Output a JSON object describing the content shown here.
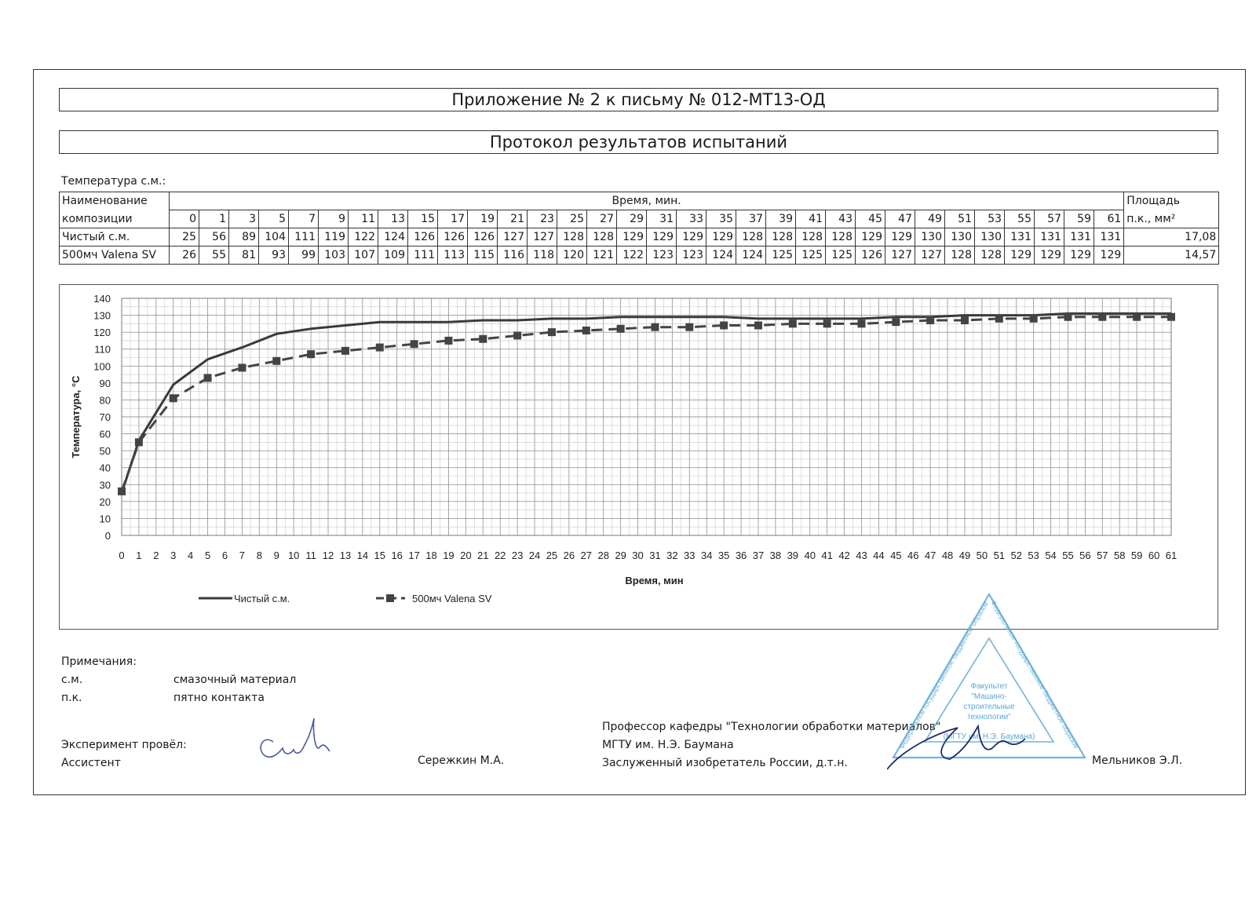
{
  "header": {
    "title": "Приложение № 2 к письму № 012-МТ13-ОД",
    "subtitle": "Протокол результатов испытаний"
  },
  "table": {
    "caption": "Температура с.м.:",
    "name_header": [
      "Наименование",
      "композиции"
    ],
    "time_header": "Время, мин.",
    "area_header": [
      "Площадь",
      "п.к., мм²"
    ],
    "times": [
      "0",
      "1",
      "3",
      "5",
      "7",
      "9",
      "11",
      "13",
      "15",
      "17",
      "19",
      "21",
      "23",
      "25",
      "27",
      "29",
      "31",
      "33",
      "35",
      "37",
      "39",
      "41",
      "43",
      "45",
      "47",
      "49",
      "51",
      "53",
      "55",
      "57",
      "59",
      "61"
    ],
    "rows": [
      {
        "name": "Чистый с.м.",
        "values": [
          "25",
          "56",
          "89",
          "104",
          "111",
          "119",
          "122",
          "124",
          "126",
          "126",
          "126",
          "127",
          "127",
          "128",
          "128",
          "129",
          "129",
          "129",
          "129",
          "128",
          "128",
          "128",
          "128",
          "129",
          "129",
          "130",
          "130",
          "130",
          "131",
          "131",
          "131",
          "131"
        ],
        "area": "17,08"
      },
      {
        "name": "500мч Valena SV",
        "values": [
          "26",
          "55",
          "81",
          "93",
          "99",
          "103",
          "107",
          "109",
          "111",
          "113",
          "115",
          "116",
          "118",
          "120",
          "121",
          "122",
          "123",
          "123",
          "124",
          "124",
          "125",
          "125",
          "125",
          "126",
          "127",
          "127",
          "128",
          "128",
          "129",
          "129",
          "129",
          "129"
        ],
        "area": "14,57"
      }
    ]
  },
  "chart_data": {
    "type": "line",
    "xlabel": "Время, мин",
    "ylabel": "Температура, °С",
    "xlim": [
      0,
      61
    ],
    "ylim": [
      0,
      140
    ],
    "yticks": [
      0,
      10,
      20,
      30,
      40,
      50,
      60,
      70,
      80,
      90,
      100,
      110,
      120,
      130,
      140
    ],
    "grid": true,
    "legend": "bottom-left",
    "series": [
      {
        "name": "Чистый с.м.",
        "style": "solid",
        "color": "#3a3a3a",
        "x": [
          0,
          1,
          3,
          5,
          7,
          9,
          11,
          13,
          15,
          17,
          19,
          21,
          23,
          25,
          27,
          29,
          31,
          33,
          35,
          37,
          39,
          41,
          43,
          45,
          47,
          49,
          51,
          53,
          55,
          57,
          59,
          61
        ],
        "y": [
          25,
          56,
          89,
          104,
          111,
          119,
          122,
          124,
          126,
          126,
          126,
          127,
          127,
          128,
          128,
          129,
          129,
          129,
          129,
          128,
          128,
          128,
          128,
          129,
          129,
          130,
          130,
          130,
          131,
          131,
          131,
          131
        ]
      },
      {
        "name": "500мч Valena SV",
        "style": "dashed-square",
        "color": "#444444",
        "x": [
          0,
          1,
          3,
          5,
          7,
          9,
          11,
          13,
          15,
          17,
          19,
          21,
          23,
          25,
          27,
          29,
          31,
          33,
          35,
          37,
          39,
          41,
          43,
          45,
          47,
          49,
          51,
          53,
          55,
          57,
          59,
          61
        ],
        "y": [
          26,
          55,
          81,
          93,
          99,
          103,
          107,
          109,
          111,
          113,
          115,
          116,
          118,
          120,
          121,
          122,
          123,
          123,
          124,
          124,
          125,
          125,
          125,
          126,
          127,
          127,
          128,
          128,
          129,
          129,
          129,
          129
        ]
      }
    ]
  },
  "notes": {
    "title": "Примечания:",
    "items": [
      {
        "abbr": "с.м.",
        "meaning": "смазочный материал"
      },
      {
        "abbr": "п.к.",
        "meaning": "пятно контакта"
      }
    ]
  },
  "signatures": {
    "left_line1": "Эксперимент провёл:",
    "left_line2": "Ассистент",
    "left_name": "Сережкин М.А.",
    "right_line1": "Профессор кафедры \"Технологии обработки материалов\"",
    "right_line2": "МГТУ им. Н.Э. Баумана",
    "right_line3": "Заслуженный изобретатель России, д.т.н.",
    "right_name": "Мельников Э.Л."
  },
  "stamp": {
    "outer_text": "Федеральное государственное бюджетное образовательное учреждение высшего профессионального образования Московский государственный технический университет имени Н.Э. Баумана",
    "center_text": [
      "Факультет",
      "\"Машино-",
      "строительные",
      "технологии\""
    ],
    "bottom_text": "(МГТУ им. Н.Э. Баумана)",
    "color": "#5aa7d6"
  }
}
